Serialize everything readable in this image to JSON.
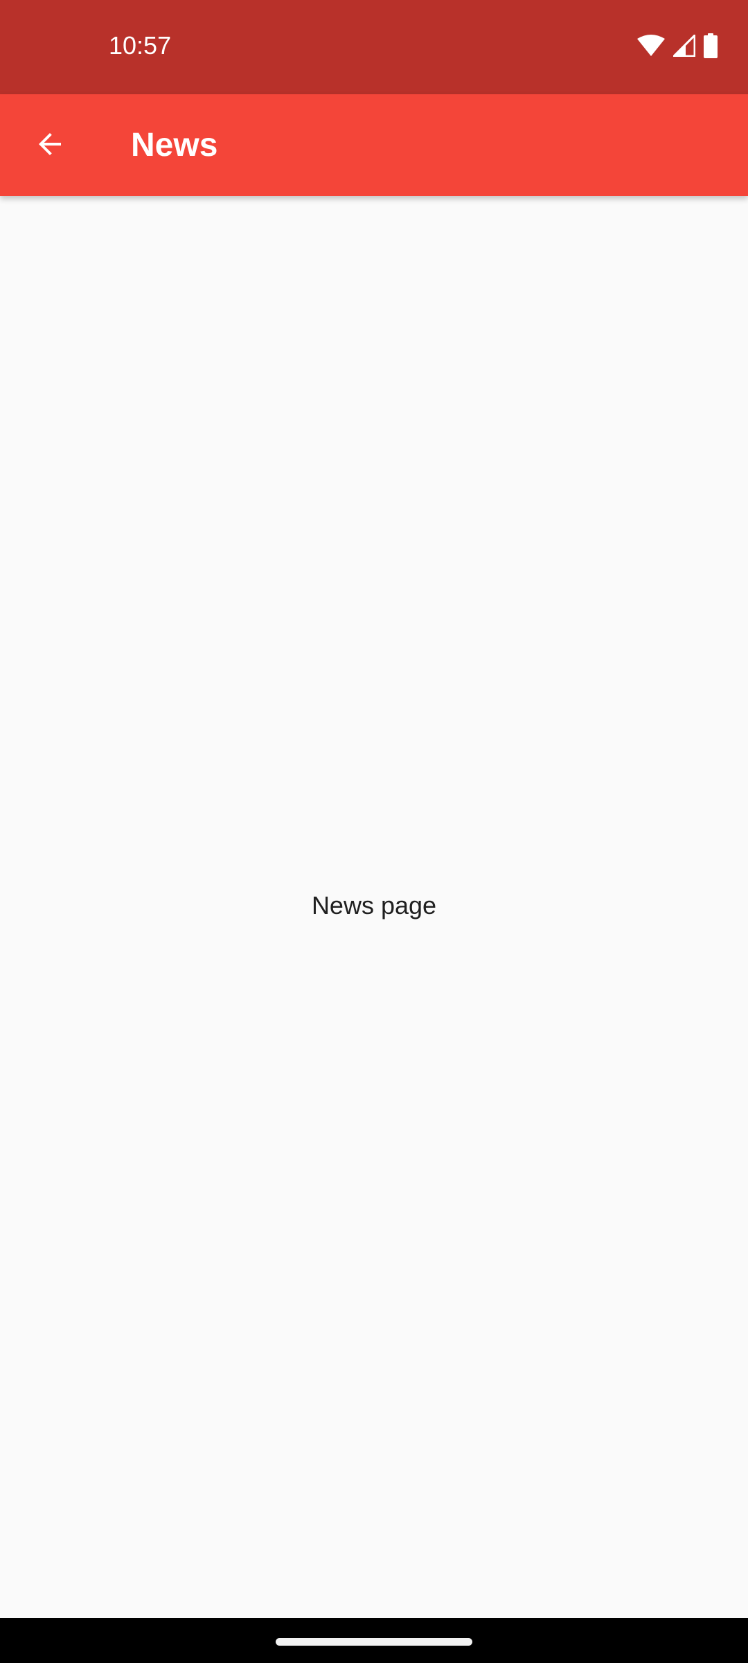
{
  "status_bar": {
    "time": "10:57",
    "icons": [
      "wifi-icon",
      "cellular-signal-icon",
      "battery-icon"
    ],
    "color": "#b8312a"
  },
  "app_bar": {
    "title": "News",
    "back_icon": "arrow-back-icon",
    "color": "#f44539"
  },
  "main": {
    "text": "News page"
  },
  "nav_bar": {
    "indicator": "home-indicator"
  }
}
